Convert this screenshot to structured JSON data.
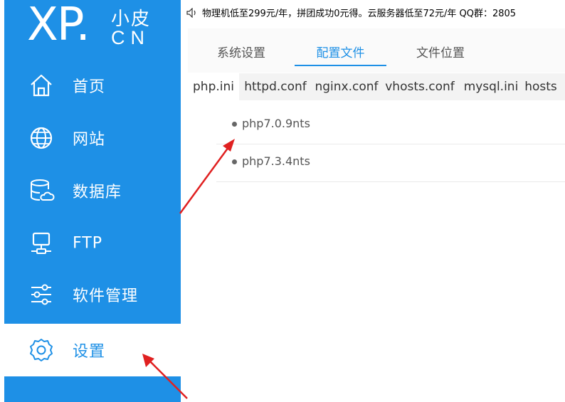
{
  "logo": {
    "xp": "XP.",
    "small_top": "小皮",
    "small_bottom": "CN"
  },
  "notice": {
    "icon": "speaker-icon",
    "text": "物理机低至299元/年，拼团成功0元得。云服务器低至72元/年 QQ群：2805"
  },
  "sidebar": {
    "items": [
      {
        "label": "首页",
        "icon": "home-icon"
      },
      {
        "label": "网站",
        "icon": "globe-icon"
      },
      {
        "label": "数据库",
        "icon": "database-icon"
      },
      {
        "label": "FTP",
        "icon": "ftp-icon"
      },
      {
        "label": "软件管理",
        "icon": "sliders-icon"
      },
      {
        "label": "设置",
        "icon": "gear-icon",
        "active": true
      }
    ]
  },
  "main_tabs": [
    {
      "label": "系统设置"
    },
    {
      "label": "配置文件",
      "active": true
    },
    {
      "label": "文件位置"
    }
  ],
  "sub_tabs": [
    {
      "label": "php.ini",
      "active": true
    },
    {
      "label": "httpd.conf"
    },
    {
      "label": "nginx.conf"
    },
    {
      "label": "vhosts.conf"
    },
    {
      "label": "mysql.ini"
    },
    {
      "label": "hosts"
    }
  ],
  "php_versions": [
    {
      "label": "php7.0.9nts"
    },
    {
      "label": "php7.3.4nts"
    }
  ],
  "colors": {
    "sidebar": "#1e90e6",
    "accent": "#1e90e6",
    "annotation_arrow": "#e02020"
  }
}
